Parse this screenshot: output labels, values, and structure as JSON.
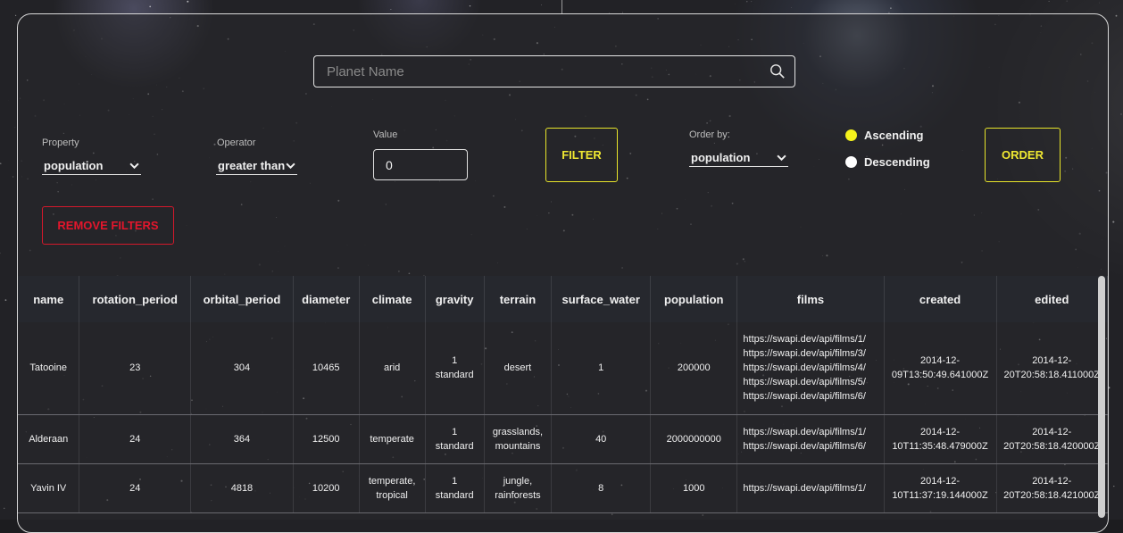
{
  "search": {
    "placeholder": "Planet Name",
    "value": ""
  },
  "filters": {
    "property_label": "Property",
    "property_value": "population",
    "operator_label": "Operator",
    "operator_value": "greater than",
    "value_label": "Value",
    "value_value": "0",
    "filter_button": "FILTER",
    "remove_filters_button": "REMOVE FILTERS"
  },
  "order": {
    "label": "Order by:",
    "value": "population",
    "ascending_label": "Ascending",
    "descending_label": "Descending",
    "selected": "Ascending",
    "order_button": "ORDER"
  },
  "colors": {
    "accent_yellow": "#f0e832",
    "danger_red": "#e3162c"
  },
  "table": {
    "headers": [
      "name",
      "rotation_period",
      "orbital_period",
      "diameter",
      "climate",
      "gravity",
      "terrain",
      "surface_water",
      "population",
      "films",
      "created",
      "edited"
    ],
    "rows": [
      [
        "Tatooine",
        "23",
        "304",
        "10465",
        "arid",
        "1\nstandard",
        "desert",
        "1",
        "200000",
        "https://swapi.dev/api/films/1/\nhttps://swapi.dev/api/films/3/\nhttps://swapi.dev/api/films/4/\nhttps://swapi.dev/api/films/5/\nhttps://swapi.dev/api/films/6/",
        "2014-12-\n09T13:50:49.641000Z",
        "2014-12-\n20T20:58:18.411000Z"
      ],
      [
        "Alderaan",
        "24",
        "364",
        "12500",
        "temperate",
        "1\nstandard",
        "grasslands,\nmountains",
        "40",
        "2000000000",
        "https://swapi.dev/api/films/1/\nhttps://swapi.dev/api/films/6/",
        "2014-12-\n10T11:35:48.479000Z",
        "2014-12-\n20T20:58:18.420000Z"
      ],
      [
        "Yavin IV",
        "24",
        "4818",
        "10200",
        "temperate,\ntropical",
        "1\nstandard",
        "jungle,\nrainforests",
        "8",
        "1000",
        "https://swapi.dev/api/films/1/",
        "2014-12-\n10T11:37:19.144000Z",
        "2014-12-\n20T20:58:18.421000Z"
      ]
    ]
  }
}
